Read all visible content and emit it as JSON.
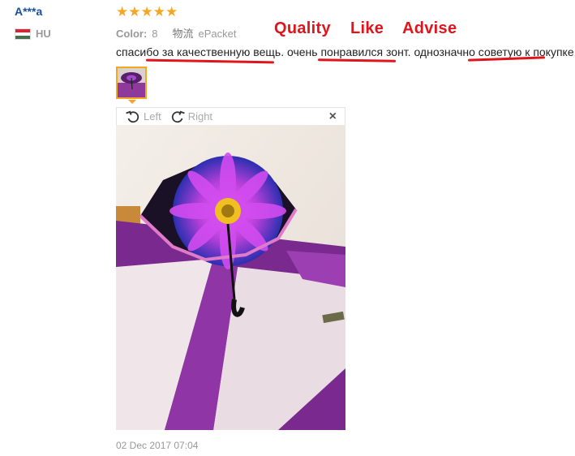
{
  "reviewer": {
    "name": "A***a",
    "country_code": "HU"
  },
  "rating": {
    "stars": 5,
    "max": 5
  },
  "meta": {
    "color_label": "Color:",
    "color_value": "8",
    "shipping_label": "物流",
    "shipping_value": "ePacket"
  },
  "annotations": {
    "quality": "Quality",
    "like": "Like",
    "advise": "Advise"
  },
  "review": {
    "seg1": "спасибо ",
    "seg2": "за качественную вещь",
    "seg3": ". очень ",
    "seg4": "понравился зонт",
    "seg5": ". однозначно ",
    "seg6": "советую к покупке",
    "seg7": "."
  },
  "viewer": {
    "left_label": "Left",
    "right_label": "Right",
    "close_label": "×"
  },
  "date": "02 Dec 2017 07:04",
  "colors": {
    "accent_red": "#e0141b",
    "star_orange": "#f5a623",
    "name_blue": "#1b4f9c"
  }
}
